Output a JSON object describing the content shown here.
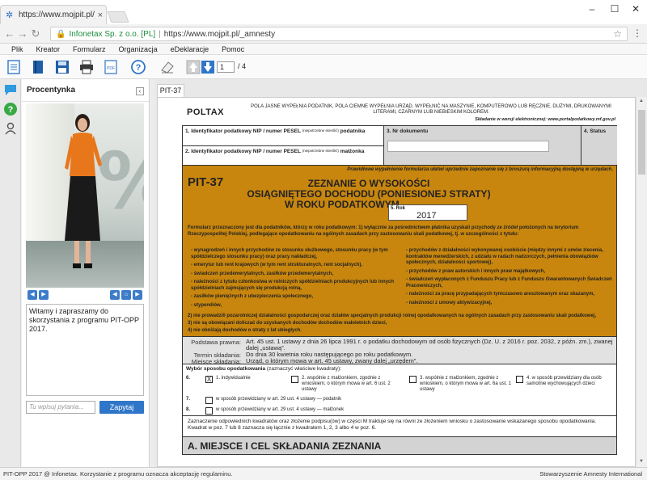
{
  "browser": {
    "tab_title": "https://www.mojpit.pl/_a",
    "tab_close": "×",
    "window_controls": [
      "–",
      "☐",
      "✕"
    ],
    "nav": [
      "←",
      "→",
      "C",
      "⌂"
    ],
    "site_name": "Infonetax Sp. z o.o. [PL]",
    "url": "https://www.mojpit.pl/_amnesty",
    "star": "☆",
    "menu": "⋮"
  },
  "menu": [
    "Plik",
    "Kreator",
    "Formularz",
    "Organizacja",
    "eDeklaracje",
    "Pomoc"
  ],
  "toolbar": {
    "page_current": "1",
    "page_total": "/ 4"
  },
  "assistant": {
    "title": "Procentynka",
    "collapse": "‹",
    "video_sign": "%",
    "controls": [
      "◀",
      "▶",
      "◀",
      "⌂",
      "▶"
    ],
    "chat_text": "Witamy i zapraszamy do skorzystania z programu PIT-OPP 2017.",
    "ask_placeholder": "Tu wpisuj pytania...",
    "ask_button": "Zapytaj"
  },
  "document": {
    "tab": "PIT-37",
    "poltax": "POLTAX",
    "instructions": "POLA JASNE WYPEŁNIA PODATNIK, POLA CIEMNE WYPEŁNIA URZĄD. WYPEŁNIĆ NA MASZYNIE, KOMPUTEROWO LUB RĘCZNIE, DUŻYMI, DRUKOWANYMI LITERAMI, CZARNYM LUB NIEBIESKIM KOLOREM.",
    "electronic_note": "Składanie w wersji elektronicznej: www.portalpodatkowy.mf.gov.pl",
    "field1_label": "1. Identyfikator podatkowy NIP / numer PESEL",
    "field1_suffix": "(niepotrzebne skreślić)",
    "field1_who": "podatnika",
    "field2_label": "2. Identyfikator podatkowy NIP / numer PESEL",
    "field2_suffix": "(niepotrzebne skreślić)",
    "field2_who": "małżonka",
    "field3_label": "3. Nr dokumentu",
    "field4_label": "4. Status",
    "brochure_note": "Prawidłowe wypełnienie formularza ułatwi uprzednie zapoznanie się z broszurą informacyjną dostępną w urzędach.",
    "form_code": "PIT-37",
    "title_lines": [
      "ZEZNANIE O WYSOKOŚCI",
      "OSIĄGNIĘTEGO DOCHODU (PONIESIONEJ STRATY)",
      "W ROKU PODATKOWYM"
    ],
    "year_label": "5. Rok",
    "year_value": "2017",
    "intro": "Formularz przeznaczony jest dla podatników, którzy w roku podatkowym: 1) wyłącznie za pośrednictwem płatnika uzyskali przychody ze źródeł położonych na terytorium Rzeczypospolitej Polskiej, podlegające opodatkowaniu na ogólnych zasadach przy zastosowaniu skali podatkowej, tj. w szczególności z tytułu:",
    "left_items": [
      "- wynagrodzeń i innych przychodów ze stosunku służbowego, stosunku pracy (w tym spółdzielczego stosunku pracy) oraz pracy nakładczej,",
      "- emerytur lub rent krajowych (w tym rent strukturalnych, rent socjalnych),",
      "- świadczeń przedemerytalnych, zasiłków przedemerytalnych,",
      "- należności z tytułu członkostwa w rolniczych spółdzielniach produkcyjnych lub innych spółdzielniach zajmujących się produkcją rolną,",
      "- zasiłków pieniężnych z ubezpieczenia społecznego,",
      "- stypendiów,"
    ],
    "right_items": [
      "- przychodów z działalności wykonywanej osobiście (między innymi z umów zlecenia, kontraktów menedżerskich, z udziału w radach nadzorczych, pełnienia obowiązków społecznych, działalności sportowej),",
      "- przychodów z praw autorskich i innych praw majątkowych,",
      "- świadczeń wypłaconych z Funduszu Pracy lub z Funduszu Gwarantowanych Świadczeń Pracowniczych,",
      "- należności za pracę przypadających tymczasowo aresztowanym oraz skazanym,",
      "- należności z umowy aktywizacyjnej,"
    ],
    "tail_items": [
      "2) nie prowadzili pozarolniczej działalności gospodarczej oraz działów specjalnych produkcji rolnej opodatkowanych na ogólnych zasadach przy zastosowaniu skali podatkowej,",
      "3) nie są obowiązani doliczać do uzyskanych dochodów dochodów małoletnich dzieci,",
      "4) nie obniżają dochodów o straty z lat ubiegłych."
    ],
    "legal": [
      {
        "k": "Podstawa prawna:",
        "v": "Art. 45 ust. 1 ustawy z dnia 26 lipca 1991 r. o podatku dochodowym od osób fizycznych (Dz. U. z 2016 r. poz. 2032, z późn. zm.), zwanej dalej „ustawą”."
      },
      {
        "k": "Termin składania:",
        "v": "Do dnia 30 kwietnia roku następującego po roku podatkowym."
      },
      {
        "k": "Miejsce składania:",
        "v": "Urząd, o którym mowa w art. 45 ustawy, zwany dalej „urzędem”."
      }
    ],
    "method_title": "Wybór sposobu opodatkowania",
    "method_hint": "(zaznaczyć właściwe kwadraty):",
    "options": [
      {
        "num": "6.",
        "mark": "X",
        "text": "1. indywidualnie"
      },
      {
        "num": "",
        "mark": "",
        "text": "2. wspólnie z małżonkiem, zgodnie z wnioskiem, o którym mowa w art. 6 ust. 2 ustawy"
      },
      {
        "num": "",
        "mark": "",
        "text": "3. wspólnie z małżonkiem, zgodnie z wnioskiem, o którym mowa w art. 6a ust. 1 ustawy"
      },
      {
        "num": "",
        "mark": "",
        "text": "4. w sposób przewidziany dla osób samotnie wychowujących dzieci"
      },
      {
        "num": "7.",
        "mark": "",
        "text": "w sposób przewidziany w art. 29 ust. 4 ustawy — podatnik"
      },
      {
        "num": "8.",
        "mark": "",
        "text": "w sposób przewidziany w art. 29 ust. 4 ustawy — małżonek"
      }
    ],
    "footnote": "Zaznaczenie odpowiednich kwadratów oraz złożenie podpisu(ów) w części M traktuje się na równi ze złożeniem wniosku o zastosowanie wskazanego sposobu opodatkowania. Kwadrat w poz. 7 lub 8 zaznacza się łącznie z kwadratem 1, 2, 3 albo 4 w poz. 6.",
    "section_a": "A. MIEJSCE I CEL SKŁADANIA ZEZNANIA"
  },
  "status": {
    "left": "PIT-OPP 2017 @ Infonetax. Korzystanie z programu oznacza akceptację regulaminu.",
    "right": "Stowarzyszenie Amnesty International"
  },
  "colors": {
    "form_orange": "#c8860e",
    "accent_blue": "#2f76c9",
    "secure_green": "#1e8e3e"
  }
}
